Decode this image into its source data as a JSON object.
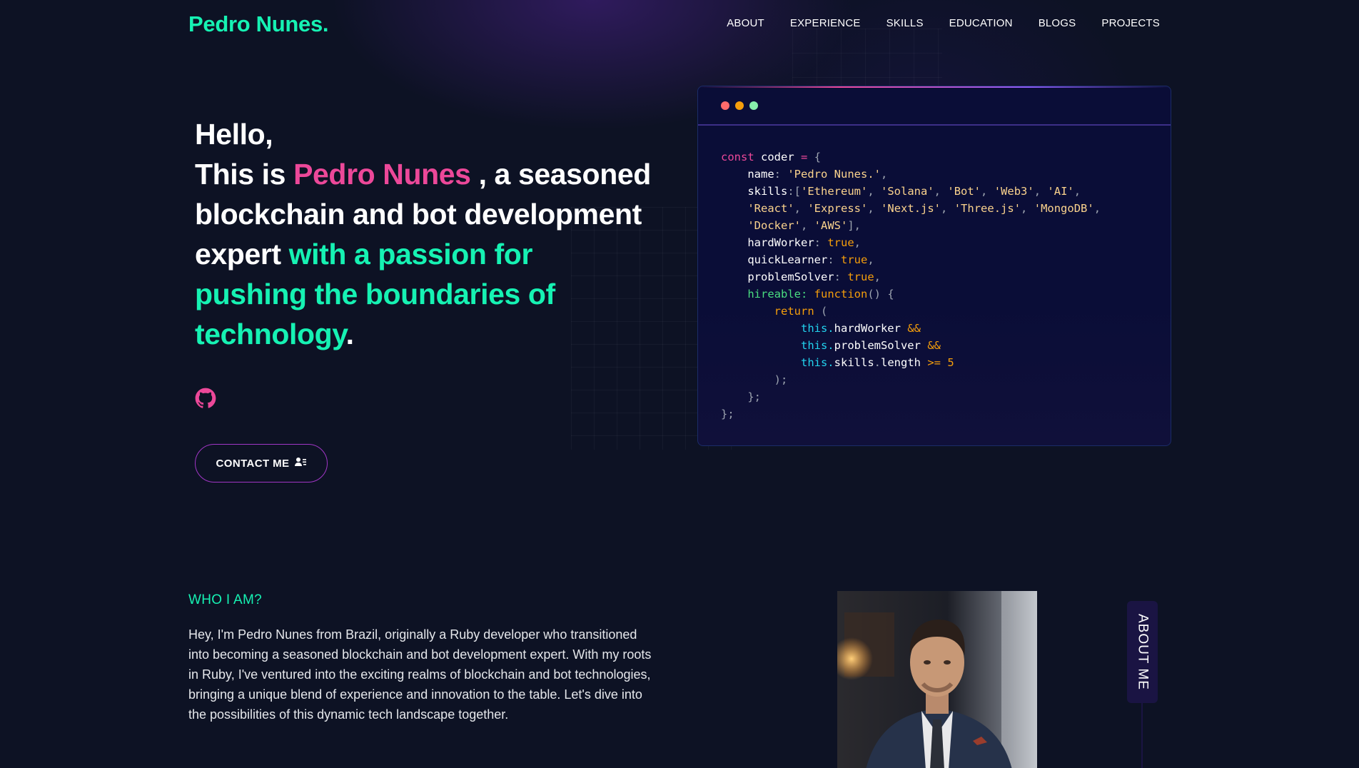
{
  "nav": {
    "brand": "Pedro Nunes.",
    "items": [
      {
        "label": "ABOUT"
      },
      {
        "label": "EXPERIENCE"
      },
      {
        "label": "SKILLS"
      },
      {
        "label": "EDUCATION"
      },
      {
        "label": "BLOGS"
      },
      {
        "label": "PROJECTS"
      }
    ]
  },
  "hero": {
    "greeting": "Hello,",
    "this_is": "This is",
    "name": "Pedro Nunes",
    "after_name": " , a seasoned blockchain and bot development expert",
    "passion": "with a passion for pushing the boundaries of technology",
    "period": ".",
    "github_icon": "github-icon",
    "contact_label": "CONTACT ME",
    "contact_icon": "user-contact-icon"
  },
  "code_card": {
    "dots": [
      "#ff6b6b",
      "#f59e0b",
      "#86efac"
    ],
    "lines": [
      "const coder = {",
      "name: 'Pedro Nunes.',",
      "skills:['Ethereum', 'Solana', 'Bot', 'Web3', 'AI',",
      "'React', 'Express', 'Next.js', 'Three.js', 'MongoDB',",
      "'Docker', 'AWS'],",
      "hardWorker: true,",
      "quickLearner: true,",
      "problemSolver: true,",
      "hireable: function() {",
      "return (",
      "this.hardWorker &&",
      "this.problemSolver &&",
      "this.skills.length >= 5",
      ");",
      "};",
      "};"
    ]
  },
  "about": {
    "title": "WHO I AM?",
    "text": "Hey, I'm Pedro Nunes from Brazil, originally a Ruby developer who transitioned into becoming a seasoned blockchain and bot development expert. With my roots in Ruby, I've ventured into the exciting realms of blockchain and bot technologies, bringing a unique blend of experience and innovation to the table. Let's dive into the possibilities of this dynamic tech landscape together.",
    "tab_label": "ABOUT ME"
  },
  "colors": {
    "accent_green": "#16f2b3",
    "accent_pink": "#ec4899",
    "background": "#0d1224"
  }
}
